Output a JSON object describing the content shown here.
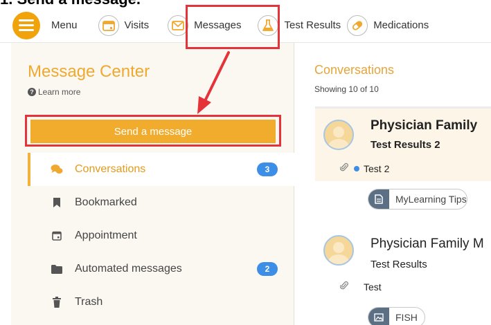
{
  "caption": "1. Send a message.",
  "nav": {
    "menu": "Menu",
    "visits": "Visits",
    "messages": "Messages",
    "test_results": "Test Results",
    "medications": "Medications"
  },
  "message_center": {
    "title": "Message Center",
    "learn_more": "Learn more",
    "send_button": "Send a message"
  },
  "folders": [
    {
      "label": "Conversations",
      "badge": "3"
    },
    {
      "label": "Bookmarked"
    },
    {
      "label": "Appointment"
    },
    {
      "label": "Automated messages",
      "badge": "2"
    },
    {
      "label": "Trash"
    }
  ],
  "conversations": {
    "title": "Conversations",
    "showing": "Showing 10 of 10",
    "items": [
      {
        "from": "Physician Family",
        "subject": "Test Results 2",
        "preview": "Test 2",
        "tag": "MyLearning Tips"
      },
      {
        "from": "Physician Family M",
        "subject": "Test Results",
        "preview": "Test",
        "tag": "FISH"
      }
    ]
  },
  "colors": {
    "accent": "#f1ac2d",
    "highlight": "#e5333a",
    "badge": "#3d8ee6"
  }
}
